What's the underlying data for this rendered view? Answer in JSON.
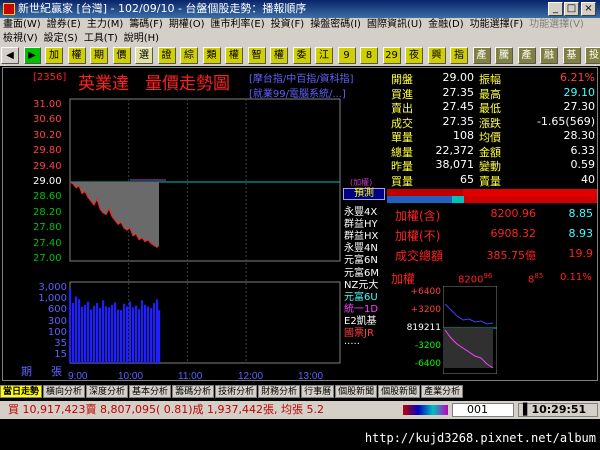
{
  "window": {
    "title": "新世紀贏家 [台灣] - 102/09/10 - 台盤個股走勢：播報順序"
  },
  "menu1": [
    "畫面(W)",
    "證券(E)",
    "主力(M)",
    "籌碼(F)",
    "期權(O)",
    "匯市利率(E)",
    "投資(F)",
    "操盤密碼(I)",
    "國際資訊(U)",
    "金融(D)",
    "功能選擇(F)",
    "功能選擇(V)"
  ],
  "menu2": [
    "檢視(V)",
    "設定(S)",
    "工具(T)",
    "說明(H)"
  ],
  "toolbar": [
    "加",
    "權",
    "期",
    "價",
    "選",
    "證",
    "綜",
    "類",
    "權",
    "智",
    "權",
    "委",
    "江",
    "9",
    "8",
    "29",
    "夜",
    "興",
    "指",
    "產",
    "騰",
    "產",
    "融",
    "基",
    "投",
    "資",
    "終"
  ],
  "stock": {
    "code": "[2356]",
    "name": "英業達",
    "chart_title": "量價走勢圖",
    "links1": "[摩台指/中百指/資科指]",
    "links2": "[就業99/電腦系統/...]"
  },
  "price_axis": [
    "31.00",
    "30.60",
    "30.20",
    "29.80",
    "29.40",
    "29.00",
    "28.60",
    "28.20",
    "27.80",
    "27.40",
    "27.00"
  ],
  "ref_label": "(加權)",
  "volume_axis": [
    "3,000",
    "1,000",
    "600",
    "300",
    "100",
    "35",
    "15"
  ],
  "period_label": "期",
  "zhang_label": "張",
  "time_axis": [
    "9:00",
    "10:00",
    "11:00",
    "12:00",
    "13:00"
  ],
  "quote": [
    {
      "l": "開盤",
      "v": "29.00",
      "l2": "振幅",
      "v2": "6.21%"
    },
    {
      "l": "買進",
      "v": "27.35",
      "l2": "最高",
      "v2": "29.10"
    },
    {
      "l": "賣出",
      "v": "27.45",
      "l2": "最低",
      "v2": "27.30"
    },
    {
      "l": "成交",
      "v": "27.35",
      "l2": "漲跌",
      "v2": "-1.65(569)"
    },
    {
      "l": "單量",
      "v": "108",
      "l2": "均價",
      "v2": "28.30"
    },
    {
      "l": "總量",
      "v": "22,372",
      "l2": "金額",
      "v2": "6.33"
    },
    {
      "l": "昨量",
      "v": "38,071",
      "l2": "變動",
      "v2": "0.59"
    },
    {
      "l": "買量",
      "v": "65",
      "l2": "賣量",
      "v2": "40"
    }
  ],
  "broker_title": "預測",
  "brokers": [
    "永豐4X",
    "群益HY",
    "群益HX",
    "永豐4N",
    "元富6N",
    "元富6M",
    "NZ元大",
    "元富6U",
    "統一1D",
    "E2凱基",
    "國票JR",
    "....."
  ],
  "index_block": [
    {
      "l": "加權(含)",
      "v": "8200.96",
      "c": "8.85"
    },
    {
      "l": "加權(不)",
      "v": "6908.32",
      "c": "8.93"
    },
    {
      "l": "成交總額",
      "v": "385.75億",
      "c": "19.9"
    }
  ],
  "mini": {
    "label": "加權",
    "value": "8200",
    "value_sup": "96",
    "change": "8",
    "change_sup": "85",
    "pct": "0.11%",
    "axis": [
      "+6400",
      "+3200",
      "819211",
      "-3200",
      "-6400"
    ]
  },
  "tabs": [
    "當日走勢",
    "橫向分析",
    "深度分析",
    "基本分析",
    "籌碼分析",
    "技術分析",
    "財務分析",
    "行事曆",
    "個股新聞",
    "個股新聞",
    "產業分析"
  ],
  "status": {
    "text": "買 10,917,423賣 8,807,095( 0.81)成 1,937,442張, 均張 5.2",
    "code": "001",
    "time": "10:29:51"
  },
  "footer_url": "http://kujd3268.pixnet.net/album",
  "chart_data": {
    "type": "line",
    "title": "量價走勢圖",
    "xlabel": "",
    "ylabel": "",
    "x_ticks": [
      "9:00",
      "10:00",
      "11:00",
      "12:00",
      "13:00"
    ],
    "price_ylim": [
      27.0,
      31.0
    ],
    "ref_price": 29.0,
    "series": [
      {
        "name": "",
        "time": [
          0,
          3,
          6,
          9,
          12,
          15,
          18,
          21,
          24,
          27,
          30,
          33,
          36,
          39,
          42,
          45,
          48,
          51,
          54,
          57,
          60,
          63,
          66,
          69,
          72,
          75,
          78,
          81,
          84,
          87,
          89
        ],
        "values": [
          29.0,
          28.95,
          28.85,
          28.9,
          28.7,
          28.75,
          28.6,
          28.5,
          28.4,
          28.55,
          28.3,
          28.2,
          28.15,
          28.3,
          28.1,
          28.0,
          27.9,
          27.95,
          27.8,
          27.75,
          27.8,
          27.6,
          27.65,
          27.5,
          27.55,
          27.45,
          27.5,
          27.4,
          27.35,
          27.3,
          27.35
        ]
      }
    ],
    "volume_ylim": [
      0,
      3000
    ],
    "volume": [
      2800,
      600,
      1200,
      900,
      400,
      500,
      700,
      300,
      450,
      600,
      350,
      800,
      420,
      380,
      500,
      650,
      300,
      280,
      560,
      420,
      700,
      380,
      460,
      310,
      800,
      500,
      420,
      350,
      600,
      900,
      280
    ]
  }
}
